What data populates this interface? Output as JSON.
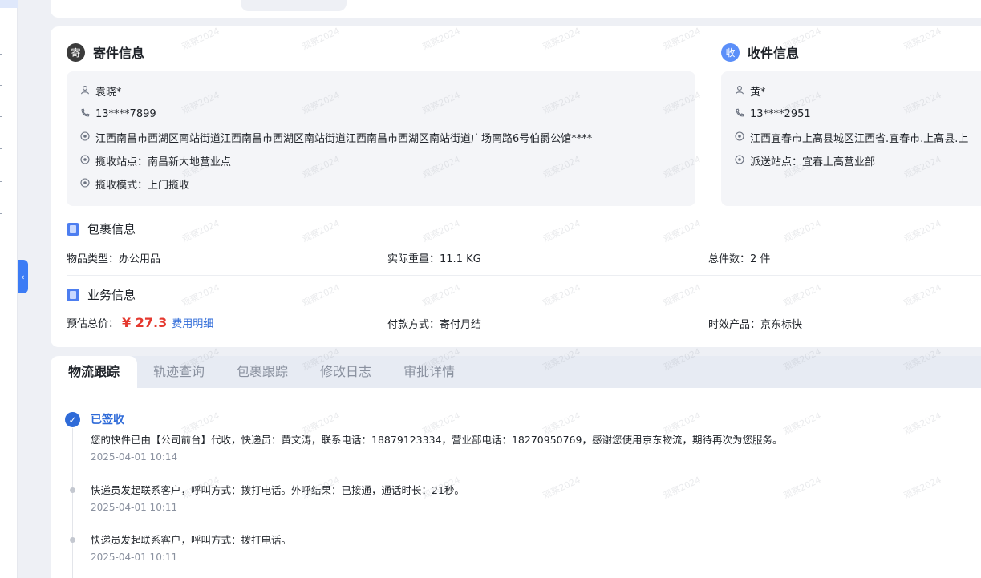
{
  "sender": {
    "badge": "寄",
    "title": "寄件信息",
    "name": "袁晓*",
    "phone": "13****7899",
    "address": "江西南昌市西湖区南站街道江西南昌市西湖区南站街道江西南昌市西湖区南站街道广场南路6号伯爵公馆****",
    "pickup_station": "揽收站点：南昌新大地营业点",
    "pickup_mode": "揽收模式：上门揽收"
  },
  "receiver": {
    "badge": "收",
    "title": "收件信息",
    "name": "黄*",
    "phone": "13****2951",
    "address": "江西宜春市上高县城区江西省.宜春市.上高县.上",
    "delivery_station": "派送站点：宜春上高营业部"
  },
  "package": {
    "title": "包裹信息",
    "item_type_label": "物品类型：",
    "item_type": "办公用品",
    "weight_label": "实际重量：",
    "weight": "11.1 KG",
    "count_label": "总件数：",
    "count": "2 件"
  },
  "business": {
    "title": "业务信息",
    "price_label": "预估总价：",
    "price": "¥ 27.3",
    "fee_detail_link": "费用明细",
    "payment_label": "付款方式：",
    "payment": "寄付月结",
    "product_label": "时效产品：",
    "product": "京东标快"
  },
  "tabs": [
    {
      "label": "物流跟踪",
      "active": true
    },
    {
      "label": "轨迹查询",
      "active": false
    },
    {
      "label": "包裹跟踪",
      "active": false
    },
    {
      "label": "修改日志",
      "active": false
    },
    {
      "label": "审批详情",
      "active": false
    }
  ],
  "timeline": [
    {
      "status": "已签收",
      "desc": "您的快件已由【公司前台】代收，快递员：黄文涛，联系电话：18879123334，营业部电话：18270950769，感谢您使用京东物流，期待再次为您服务。",
      "time": "2025-04-01 10:14"
    },
    {
      "desc": "快递员发起联系客户，呼叫方式：拨打电话。外呼结果：已接通，通话时长：21秒。",
      "time": "2025-04-01 10:11"
    },
    {
      "desc": "快递员发起联系客户，呼叫方式：拨打电话。",
      "time": "2025-04-01 10:11"
    }
  ],
  "colors": {
    "accent": "#2f6bd8",
    "price": "#e5392f",
    "page_bg": "#eef0f5",
    "collapse_btn": "#3c7cf5"
  },
  "icons": {
    "collapse": "chevron-left-icon",
    "person": "person-icon",
    "phone": "phone-icon",
    "location": "location-pin-icon",
    "check": "check-icon"
  },
  "watermark_text": "观察2024"
}
